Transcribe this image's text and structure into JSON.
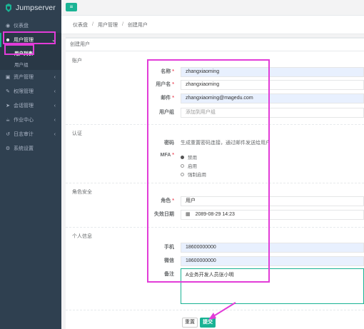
{
  "app": {
    "name": "Jumpserver"
  },
  "sidebar": {
    "items": [
      {
        "label": "仪表盘",
        "icon": "dashboard-icon"
      },
      {
        "label": "用户管理",
        "icon": "users-icon",
        "active": true
      },
      {
        "label": "资产管理",
        "icon": "inbox-icon"
      },
      {
        "label": "权限管理",
        "icon": "edit-icon"
      },
      {
        "label": "会话管理",
        "icon": "send-icon"
      },
      {
        "label": "作业中心",
        "icon": "coffee-icon"
      },
      {
        "label": "日志审计",
        "icon": "history-icon"
      },
      {
        "label": "系统设置",
        "icon": "gears-icon"
      }
    ],
    "sub_items": [
      {
        "label": "用户列表",
        "active": true
      },
      {
        "label": "用户组"
      }
    ]
  },
  "topbar": {
    "menu_icon": "hamburger-icon"
  },
  "breadcrumb": [
    "仪表盘",
    "用户管理",
    "创建用户"
  ],
  "panel": {
    "title": "创建用户",
    "sections": {
      "account": "账户",
      "auth": "认证",
      "role_security": "角色安全",
      "profile": "个人信息"
    },
    "fields": {
      "name": {
        "label": "名称",
        "value": "zhangxiaoming"
      },
      "username": {
        "label": "用户名",
        "value": "zhangxiaoming"
      },
      "email": {
        "label": "邮件",
        "value": "zhangxiaoming@magedu.com"
      },
      "group": {
        "label": "用户组",
        "placeholder": "添加到用户组"
      },
      "password": {
        "label": "密码",
        "hint": "生成重置密码连接，通过邮件发送给用户"
      },
      "mfa": {
        "label": "MFA",
        "options": [
          "禁用",
          "启用",
          "强制启用"
        ],
        "selected": "禁用"
      },
      "role": {
        "label": "角色",
        "value": "用户"
      },
      "expire": {
        "label": "失效日期",
        "value": "2089-08-29 14:23"
      },
      "phone": {
        "label": "手机",
        "value": "18600000000"
      },
      "wechat": {
        "label": "微信",
        "value": "18600000000"
      },
      "comment": {
        "label": "备注",
        "value": "A业务开发人员张小明"
      }
    },
    "buttons": {
      "reset": "重置",
      "submit": "提交"
    }
  },
  "colors": {
    "accent": "#1ab394",
    "sidebar": "#2f4050",
    "annotation": "#e23cd8"
  }
}
